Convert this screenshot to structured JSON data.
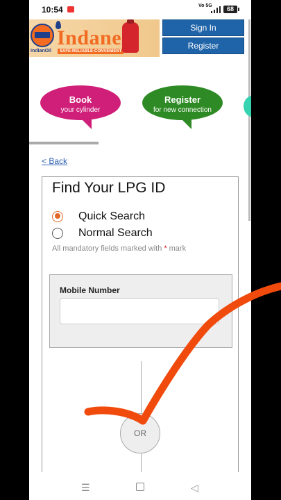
{
  "status_bar": {
    "time": "10:54",
    "network_label": "Vo 5G",
    "battery": "68"
  },
  "header": {
    "brand_small": "IndianOil",
    "brand_name": "Indane",
    "tagline": "SAFE-RELIABLE-CONVENIENT",
    "sign_in_label": "Sign In",
    "register_label": "Register"
  },
  "carousel": {
    "items": [
      {
        "title": "Book",
        "subtitle": "your cylinder",
        "color": "#cf1f78"
      },
      {
        "title": "Register",
        "subtitle": "for new connection",
        "color": "#2e8a24"
      }
    ]
  },
  "back_link": "< Back",
  "form": {
    "title": "Find Your LPG ID",
    "options": [
      {
        "label": "Quick Search",
        "selected": true
      },
      {
        "label": "Normal Search",
        "selected": false
      }
    ],
    "mandatory_prefix": "All mandatory fields marked with",
    "mandatory_star": "*",
    "mandatory_suffix": "mark",
    "mobile_label": "Mobile Number",
    "mobile_value": "",
    "or_label": "OR"
  },
  "colors": {
    "accent": "#e06a2a",
    "primary_button": "#1f63a8",
    "annotation_stroke": "#f04a0c"
  }
}
